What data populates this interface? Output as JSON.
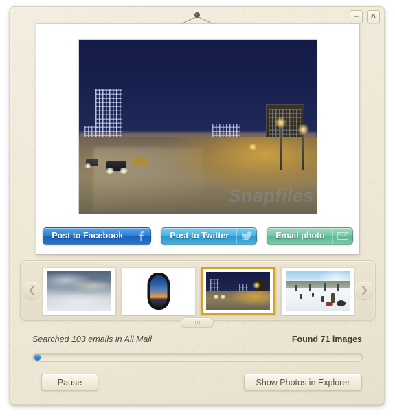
{
  "window": {
    "minimize_label": "–",
    "close_label": "✕"
  },
  "photo_viewer": {
    "main_photo_alt": "night-cityscape-street",
    "watermark": "Snapfiles"
  },
  "share_buttons": [
    {
      "label": "Post to Facebook",
      "icon": "facebook-icon",
      "glyph": "f",
      "color": "#2d7fd6"
    },
    {
      "label": "Post to Twitter",
      "icon": "twitter-bird-icon",
      "glyph": "✒",
      "color": "#45b1e3"
    },
    {
      "label": "Email photo",
      "icon": "envelope-icon",
      "glyph": "✉",
      "color": "#72c6a5"
    }
  ],
  "filmstrip": {
    "prev_label": "‹",
    "next_label": "›",
    "thumbnails": [
      {
        "alt": "clouds-from-above",
        "selected": false
      },
      {
        "alt": "airplane-window-sunset",
        "selected": false
      },
      {
        "alt": "night-cityscape-street",
        "selected": true
      },
      {
        "alt": "snow-tubing-hill",
        "selected": false
      }
    ]
  },
  "status": {
    "searched_text": "Searched 103 emails in All Mail",
    "found_text": "Found 71 images",
    "emails_searched": 103,
    "images_found": 71,
    "mailbox": "All Mail",
    "progress_percent": 1
  },
  "footer": {
    "pause_label": "Pause",
    "explorer_label": "Show Photos in Explorer"
  }
}
